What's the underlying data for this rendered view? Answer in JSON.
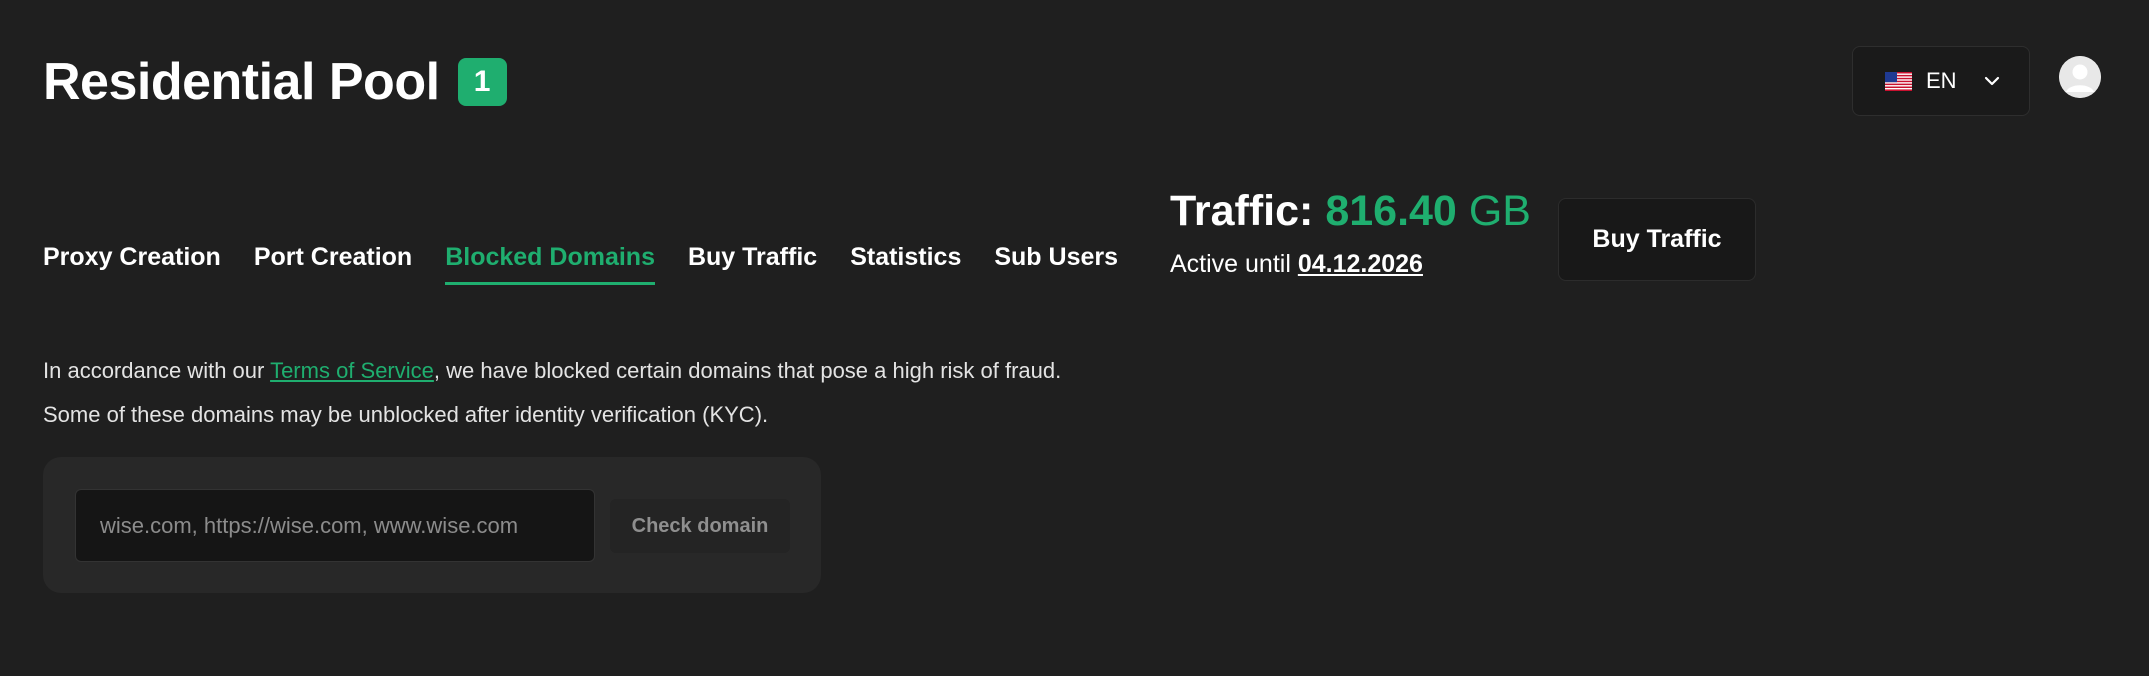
{
  "header": {
    "title": "Residential Pool",
    "badge_count": "1"
  },
  "language": {
    "flag_icon": "us-flag-icon",
    "selected": "EN"
  },
  "tabs": [
    {
      "label": "Proxy Creation",
      "active": false
    },
    {
      "label": "Port Creation",
      "active": false
    },
    {
      "label": "Blocked Domains",
      "active": true
    },
    {
      "label": "Buy Traffic",
      "active": false
    },
    {
      "label": "Statistics",
      "active": false
    },
    {
      "label": "Sub Users",
      "active": false
    }
  ],
  "traffic": {
    "label": "Traffic:",
    "value": "816.40",
    "unit": "GB",
    "active_prefix": "Active until",
    "active_date": "04.12.2026"
  },
  "buy_button": {
    "label": "Buy Traffic"
  },
  "notice": {
    "line1_prefix": "In accordance with our",
    "link_text": "Terms of Service",
    "line1_suffix": ", we have blocked certain domains that pose a high risk of fraud.",
    "line2": "Some of these domains may be unblocked after identity verification (KYC)."
  },
  "domain_check": {
    "value": "",
    "placeholder": "wise.com, https://wise.com, www.wise.com",
    "button_label": "Check domain"
  },
  "colors": {
    "background": "#1f1f1f",
    "accent": "#1fae6f",
    "card": "#282828"
  }
}
